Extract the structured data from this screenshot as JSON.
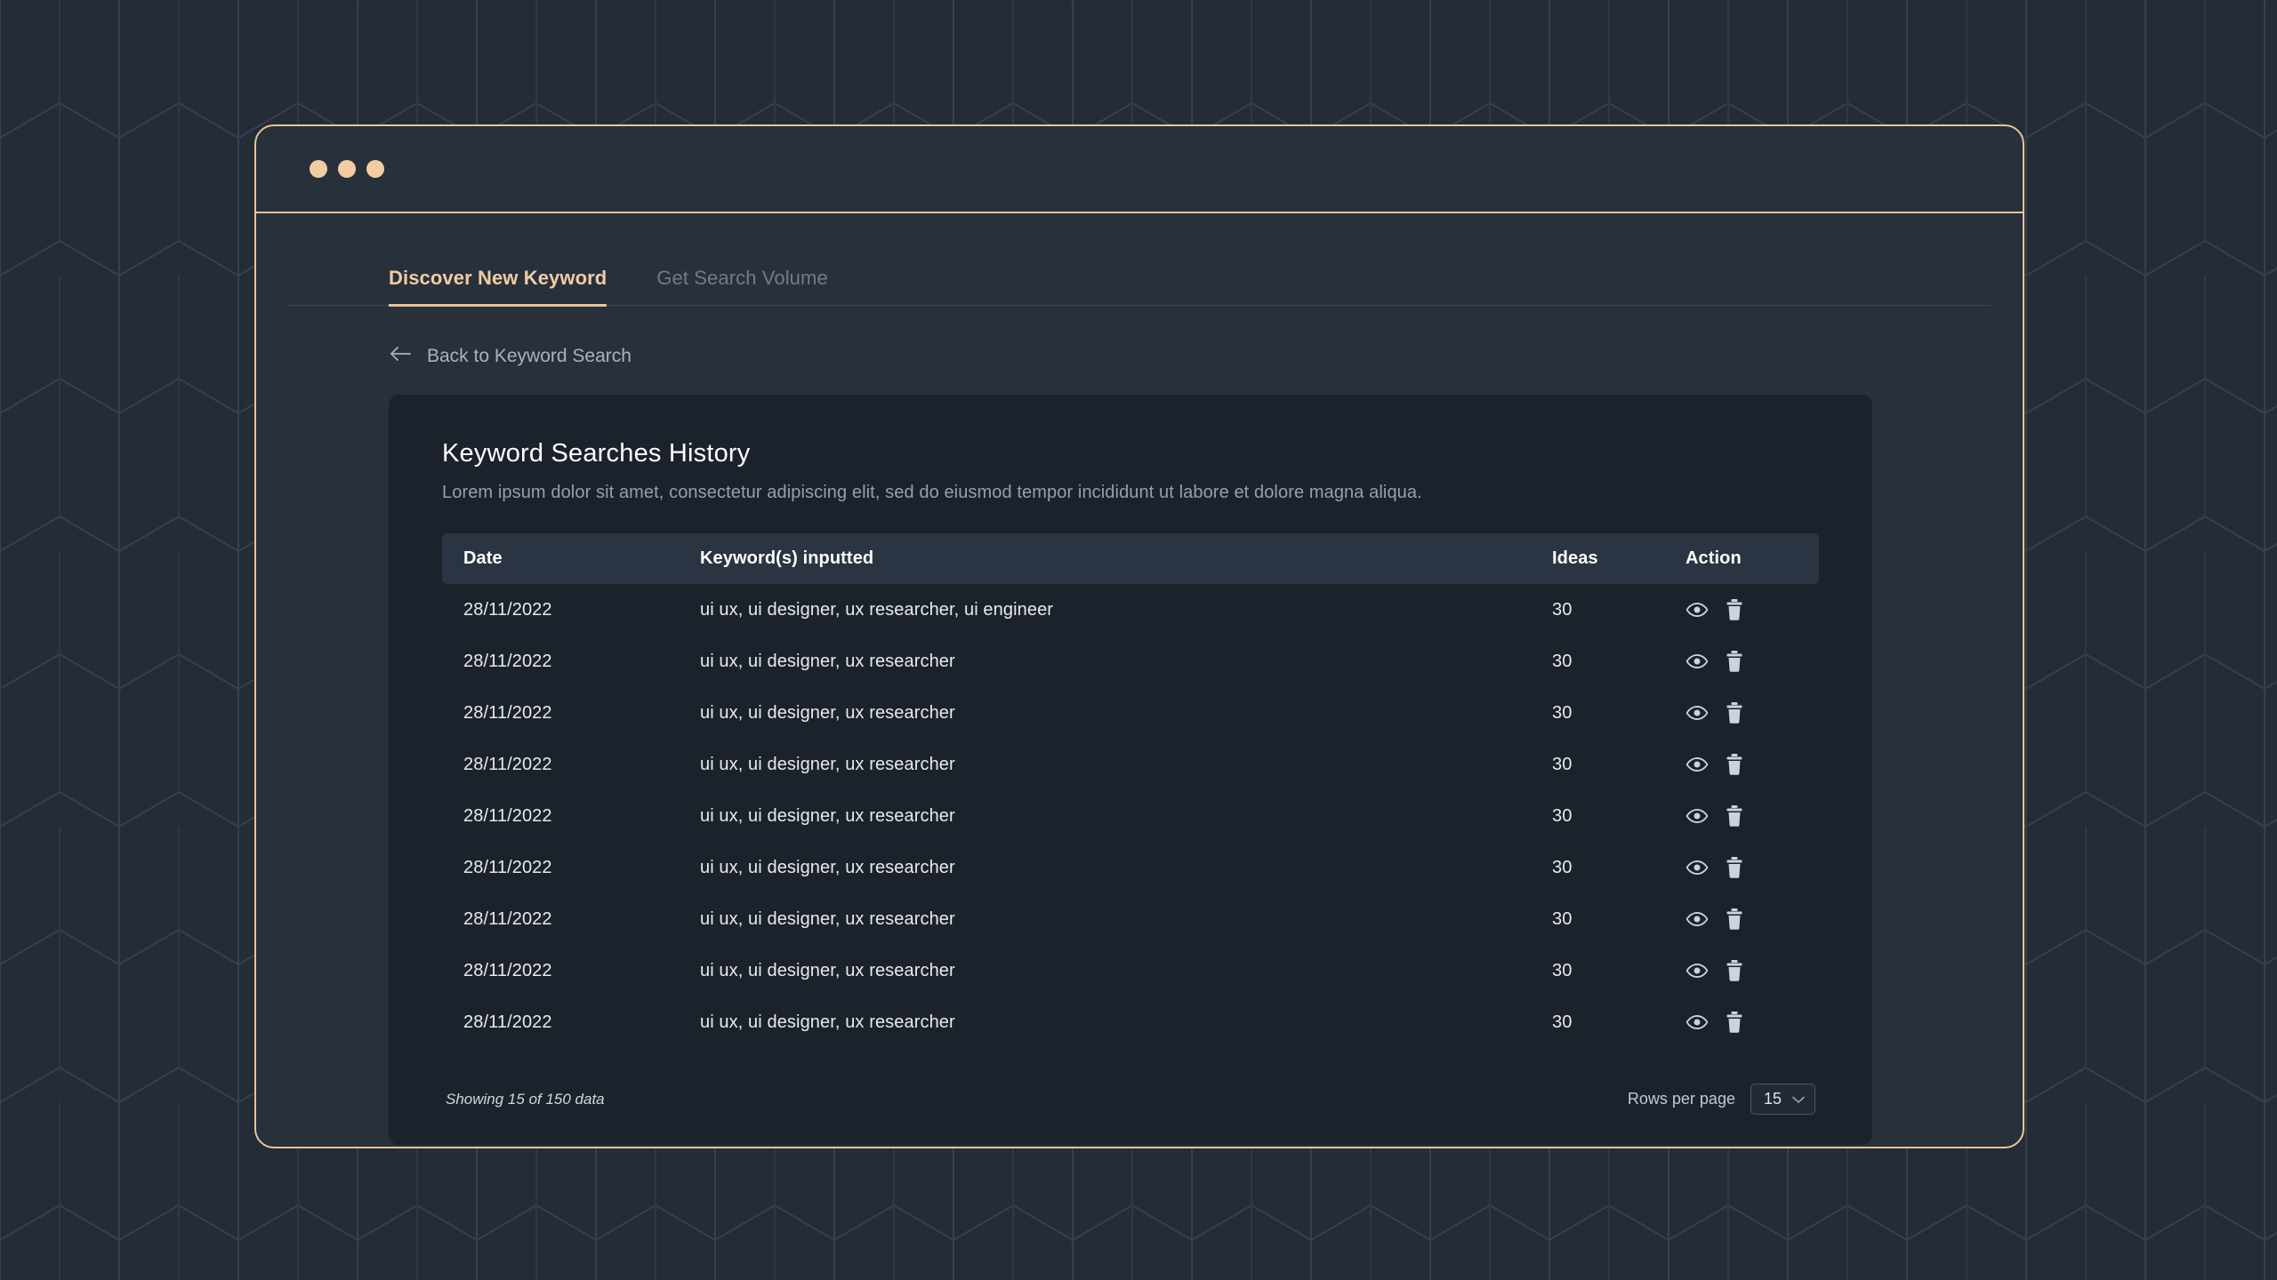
{
  "theme": {
    "page_bg": "#242c38",
    "window_bg": "#28303c",
    "window_border": "#e9c496",
    "accent": "#e9c496",
    "accent_text": "#f0cda4",
    "card_bg": "#1c222c",
    "table_header_bg": "#2b3442",
    "text_primary": "#ffffff",
    "text_muted": "#94a0b0",
    "text_inactive": "#707b8d"
  },
  "window": {
    "dots": [
      "window-dot-red",
      "window-dot-yellow",
      "window-dot-green"
    ]
  },
  "tabs": [
    {
      "label": "Discover New Keyword",
      "active": true
    },
    {
      "label": "Get Search Volume",
      "active": false
    }
  ],
  "back_link": {
    "label": "Back to Keyword Search",
    "icon": "arrow-left-icon"
  },
  "card": {
    "title": "Keyword Searches History",
    "subtitle": "Lorem ipsum dolor sit amet, consectetur adipiscing elit, sed do eiusmod tempor incididunt ut labore et dolore magna aliqua."
  },
  "table": {
    "columns": [
      {
        "key": "date",
        "label": "Date"
      },
      {
        "key": "keywords",
        "label": "Keyword(s) inputted"
      },
      {
        "key": "ideas",
        "label": "Ideas"
      },
      {
        "key": "action",
        "label": "Action"
      }
    ],
    "rows": [
      {
        "date": "28/11/2022",
        "keywords": "ui ux, ui designer, ux researcher, ui engineer",
        "ideas": "30"
      },
      {
        "date": "28/11/2022",
        "keywords": "ui ux, ui designer, ux researcher",
        "ideas": "30"
      },
      {
        "date": "28/11/2022",
        "keywords": "ui ux, ui designer, ux researcher",
        "ideas": "30"
      },
      {
        "date": "28/11/2022",
        "keywords": "ui ux, ui designer, ux researcher",
        "ideas": "30"
      },
      {
        "date": "28/11/2022",
        "keywords": "ui ux, ui designer, ux researcher",
        "ideas": "30"
      },
      {
        "date": "28/11/2022",
        "keywords": "ui ux, ui designer, ux researcher",
        "ideas": "30"
      },
      {
        "date": "28/11/2022",
        "keywords": "ui ux, ui designer, ux researcher",
        "ideas": "30"
      },
      {
        "date": "28/11/2022",
        "keywords": "ui ux, ui designer, ux researcher",
        "ideas": "30"
      },
      {
        "date": "28/11/2022",
        "keywords": "ui ux, ui designer, ux researcher",
        "ideas": "30"
      }
    ],
    "row_actions": [
      {
        "icon": "eye-icon",
        "title": "View"
      },
      {
        "icon": "trash-icon",
        "title": "Delete"
      }
    ]
  },
  "footer": {
    "showing_text": "Showing 15 of 150 data",
    "rows_per_page_label": "Rows per page",
    "rows_per_page_value": "15",
    "rows_per_page_options": [
      "15"
    ],
    "chevron_icon": "chevron-down-icon"
  }
}
